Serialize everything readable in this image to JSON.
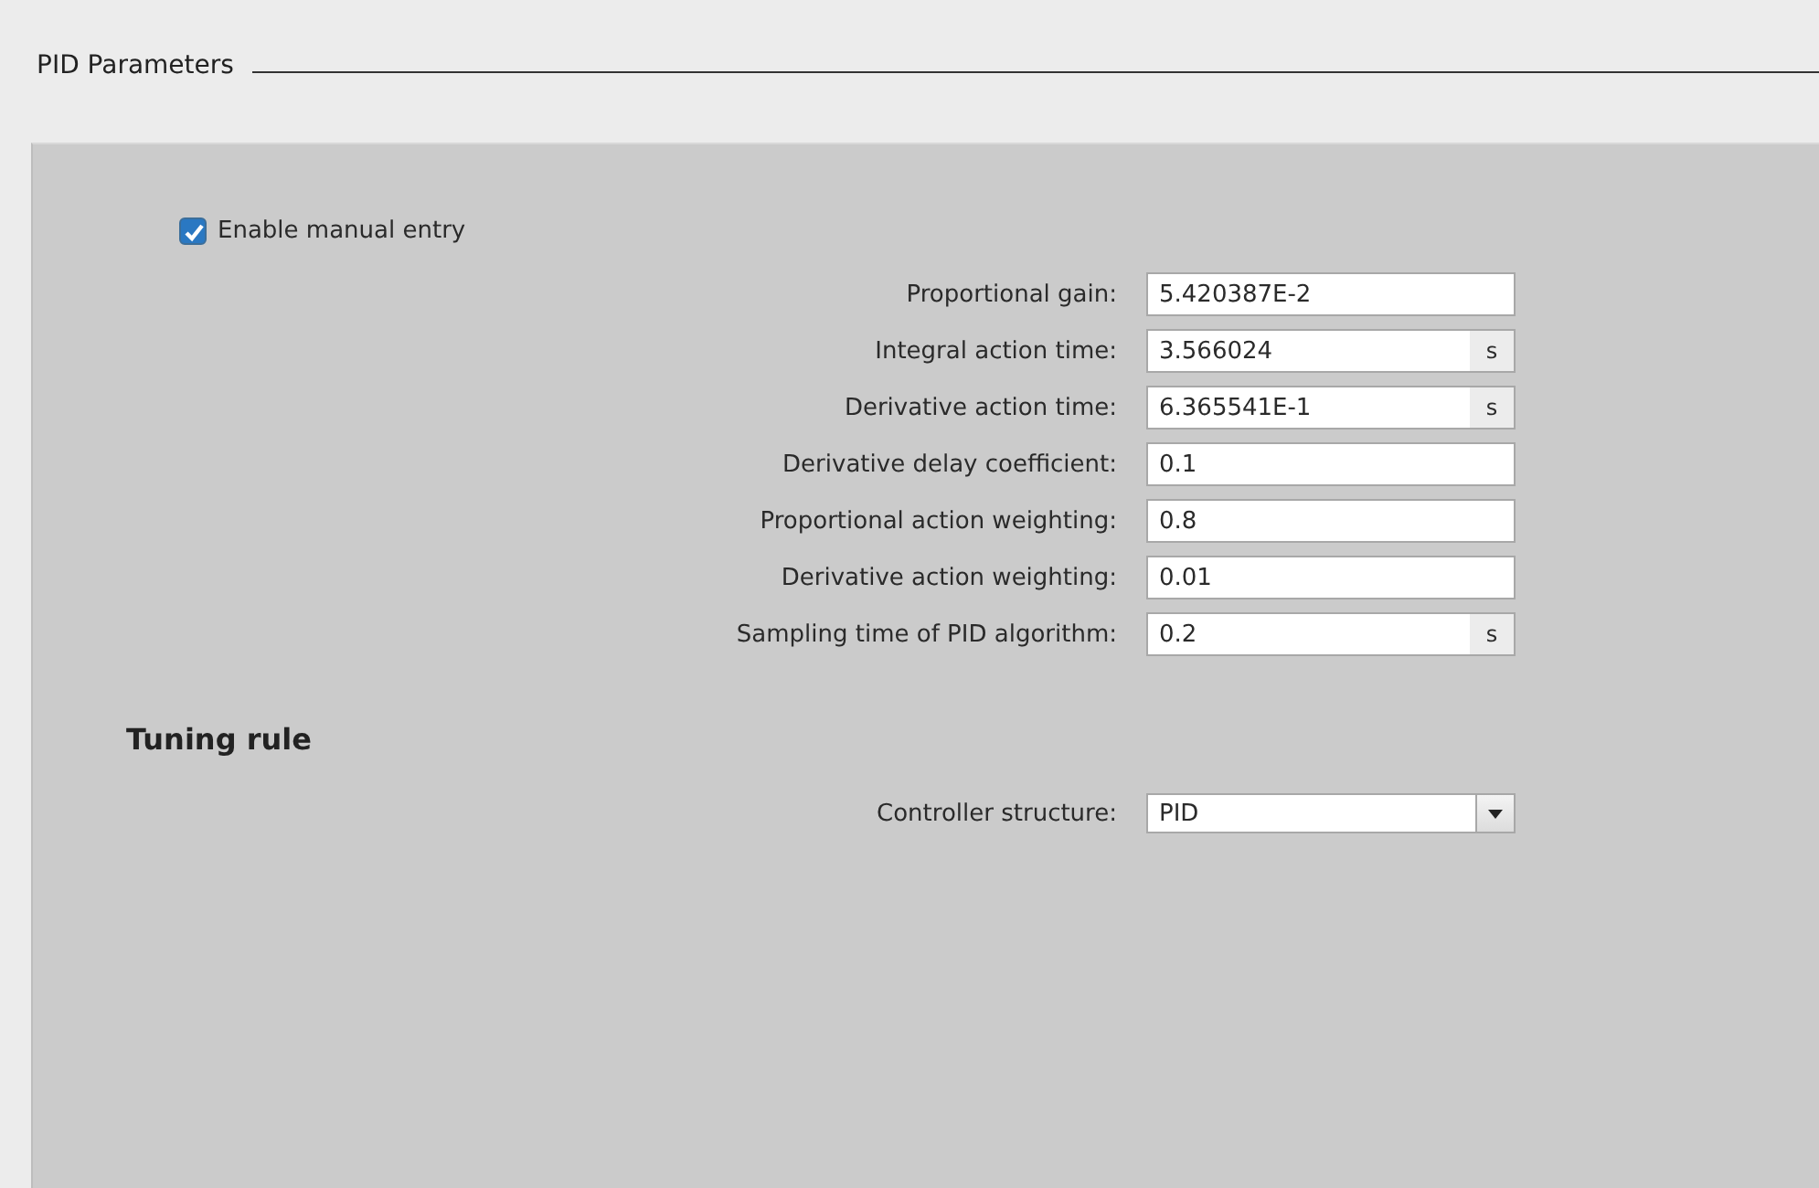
{
  "section": {
    "title": "PID Parameters"
  },
  "manual_entry": {
    "label": "Enable manual entry",
    "checked": true
  },
  "parameters": [
    {
      "label": "Proportional gain:",
      "value": "5.420387E-2"
    },
    {
      "label": "Integral action time:",
      "value": "3.566024",
      "unit": "s"
    },
    {
      "label": "Derivative action time:",
      "value": "6.365541E-1",
      "unit": "s"
    },
    {
      "label": "Derivative delay coefficient:",
      "value": "0.1"
    },
    {
      "label": "Proportional action weighting:",
      "value": "0.8"
    },
    {
      "label": "Derivative action weighting:",
      "value": "0.01"
    },
    {
      "label": "Sampling time of PID algorithm:",
      "value": "0.2",
      "unit": "s"
    }
  ],
  "tuning_rule": {
    "title": "Tuning rule",
    "controller_structure": {
      "label": "Controller structure:",
      "value": "PID"
    }
  }
}
